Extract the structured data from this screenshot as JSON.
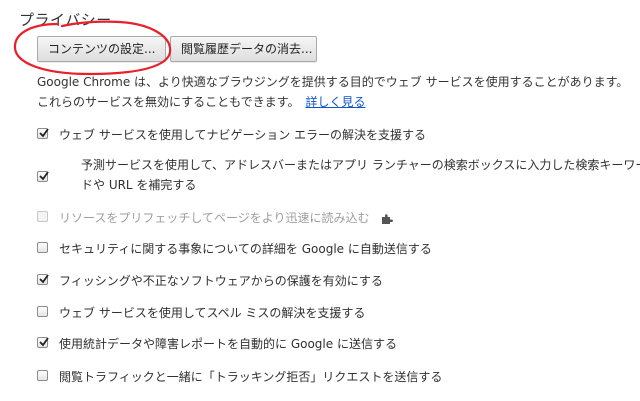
{
  "section": {
    "title": "プライバシー"
  },
  "buttons": {
    "content_settings": "コンテンツの設定...",
    "clear_browsing_data": "閲覧履歴データの消去..."
  },
  "description": {
    "text": "Google Chrome は、より快適なブラウジングを提供する目的でウェブ サービスを使用することがあります。 これらのサービスを無効にすることもできます。",
    "link": "詳しく見る"
  },
  "options": [
    {
      "label": "ウェブ サービスを使用してナビゲーション エラーの解決を支援する",
      "checked": true,
      "disabled": false
    },
    {
      "label": "予測サービスを使用して、アドレスバーまたはアプリ ランチャーの検索ボックスに入力した検索キーワードや URL を補完する",
      "checked": true,
      "disabled": false
    },
    {
      "label": "リソースをプリフェッチしてページをより迅速に読み込む",
      "checked": false,
      "disabled": true,
      "icon": "puzzle-icon"
    },
    {
      "label": "セキュリティに関する事象についての詳細を Google に自動送信する",
      "checked": false,
      "disabled": false
    },
    {
      "label": "フィッシングや不正なソフトウェアからの保護を有効にする",
      "checked": true,
      "disabled": false
    },
    {
      "label": "ウェブ サービスを使用してスペル ミスの解決を支援する",
      "checked": false,
      "disabled": false
    },
    {
      "label": "使用統計データや障害レポートを自動的に Google に送信する",
      "checked": true,
      "disabled": false
    },
    {
      "label": "閲覧トラフィックと一緒に「トラッキング拒否」リクエストを送信する",
      "checked": false,
      "disabled": false
    }
  ],
  "colors": {
    "link": "#1155cc",
    "annotation_circle": "#e8202a",
    "disabled_text": "#9e9e9e"
  }
}
